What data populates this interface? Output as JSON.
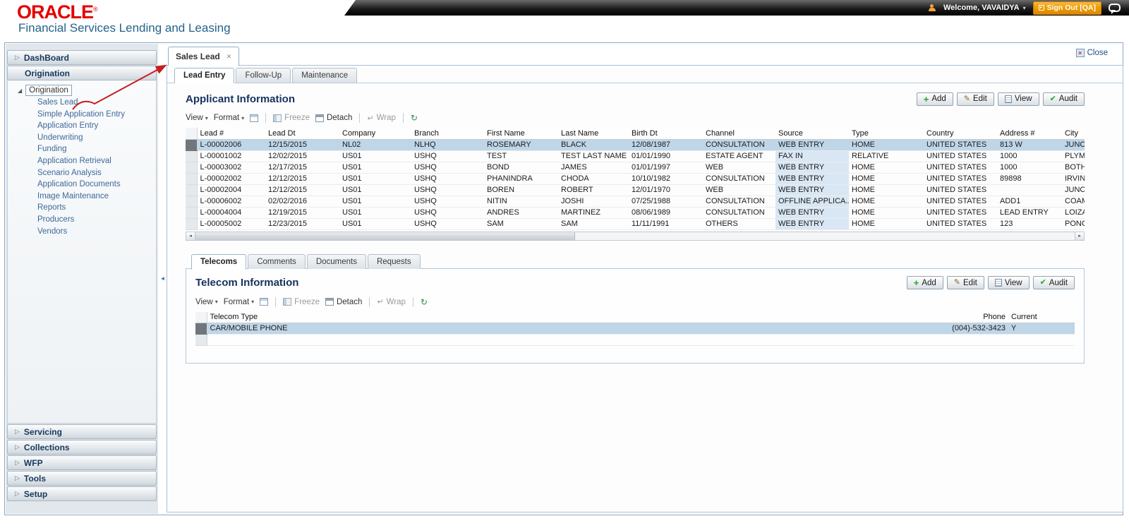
{
  "header": {
    "brand": "ORACLE",
    "brand_mark": "®",
    "subtitle": "Financial Services Lending and Leasing",
    "welcome": "Welcome, VAVAIDYA",
    "sign_out": "Sign Out [QA]"
  },
  "sidebar": {
    "dashboard_label": "DashBoard",
    "origination_label": "Origination",
    "tree_root": "Origination",
    "tree_items": [
      "Sales Lead",
      "Simple Application Entry",
      "Application Entry",
      "Underwriting",
      "Funding",
      "Application Retrieval",
      "Scenario Analysis",
      "Application Documents",
      "Image Maintenance",
      "Reports",
      "Producers",
      "Vendors"
    ],
    "sections_bottom": [
      "Servicing",
      "Collections",
      "WFP",
      "Tools",
      "Setup"
    ]
  },
  "window": {
    "tab_label": "Sales Lead",
    "close_label": "Close"
  },
  "tabs": [
    {
      "label": "Lead Entry",
      "active": true
    },
    {
      "label": "Follow-Up"
    },
    {
      "label": "Maintenance"
    }
  ],
  "toolbar_labels": {
    "view": "View",
    "format": "Format",
    "freeze": "Freeze",
    "detach": "Detach",
    "wrap": "Wrap"
  },
  "actions": [
    {
      "label": "Add"
    },
    {
      "label": "Edit"
    },
    {
      "label": "View"
    },
    {
      "label": "Audit"
    }
  ],
  "applicant": {
    "title": "Applicant Information",
    "columns": [
      "Lead #",
      "Lead Dt",
      "Company",
      "Branch",
      "First Name",
      "Last Name",
      "Birth Dt",
      "Channel",
      "Source",
      "Type",
      "Country",
      "Address #",
      "City"
    ],
    "rows": [
      {
        "selected": true,
        "cells": [
          "L-00002006",
          "12/15/2015",
          "NL02",
          "NLHQ",
          "ROSEMARY",
          "BLACK",
          "12/08/1987",
          "CONSULTATION",
          "WEB ENTRY",
          "HOME",
          "UNITED STATES",
          "813 W",
          "JUNCOS"
        ]
      },
      {
        "cells": [
          "L-00001002",
          "12/02/2015",
          "US01",
          "USHQ",
          "TEST",
          "TEST LAST NAME",
          "01/01/1990",
          "ESTATE AGENT",
          "FAX IN",
          "RELATIVE",
          "UNITED STATES",
          "1000",
          "PLYMOUTH"
        ]
      },
      {
        "cells": [
          "L-00003002",
          "12/17/2015",
          "US01",
          "USHQ",
          "BOND",
          "JAMES",
          "01/01/1997",
          "WEB",
          "WEB ENTRY",
          "HOME",
          "UNITED STATES",
          "1000",
          "BOTHELL"
        ]
      },
      {
        "cells": [
          "L-00002002",
          "12/12/2015",
          "US01",
          "USHQ",
          "PHANINDRA",
          "CHODA",
          "10/10/1982",
          "CONSULTATION",
          "WEB ENTRY",
          "HOME",
          "UNITED STATES",
          "89898",
          "IRVINE"
        ]
      },
      {
        "cells": [
          "L-00002004",
          "12/12/2015",
          "US01",
          "USHQ",
          "BOREN",
          "ROBERT",
          "12/01/1970",
          "WEB",
          "WEB ENTRY",
          "HOME",
          "UNITED STATES",
          "",
          "JUNCOS"
        ]
      },
      {
        "cells": [
          "L-00006002",
          "02/02/2016",
          "US01",
          "USHQ",
          "NITIN",
          "JOSHI",
          "07/25/1988",
          "CONSULTATION",
          "OFFLINE APPLICA...",
          "HOME",
          "UNITED STATES",
          "ADD1",
          "COAMO"
        ]
      },
      {
        "cells": [
          "L-00004004",
          "12/19/2015",
          "US01",
          "USHQ",
          "ANDRES",
          "MARTINEZ",
          "08/06/1989",
          "CONSULTATION",
          "WEB ENTRY",
          "HOME",
          "UNITED STATES",
          "LEAD ENTRY",
          "LOIZA"
        ]
      },
      {
        "cells": [
          "L-00005002",
          "12/23/2015",
          "US01",
          "USHQ",
          "SAM",
          "SAM",
          "11/11/1991",
          "OTHERS",
          "WEB ENTRY",
          "HOME",
          "UNITED STATES",
          "123",
          "PONCE"
        ]
      }
    ]
  },
  "detail_tabs": [
    {
      "label": "Telecoms",
      "active": true
    },
    {
      "label": "Comments"
    },
    {
      "label": "Documents"
    },
    {
      "label": "Requests"
    }
  ],
  "telecom": {
    "title": "Telecom Information",
    "columns": [
      "Telecom Type",
      "Phone",
      "Current"
    ],
    "rows": [
      {
        "selected": true,
        "cells": [
          "CAR/MOBILE PHONE",
          "(004)-532-3423",
          "Y"
        ]
      },
      {
        "cells": [
          "",
          "",
          ""
        ]
      }
    ]
  },
  "icons": {
    "caret": "▾",
    "chevron": "▷",
    "tree_expanded": "◢",
    "tab_close": "✕",
    "close_box": "✕",
    "add": "+",
    "edit": "✎",
    "audit": "✔",
    "wrap": "↵",
    "refresh": "↻",
    "scroll_left": "◂",
    "scroll_right": "▸",
    "splitter": "◄"
  },
  "colors": {
    "oracle_red": "#e40000",
    "subtitle_blue": "#24638c",
    "signout_orange": "#ef9c00",
    "annotation_red": "#c81e1e",
    "selected_row": "#bfd6e8",
    "source_column": "#d9e7f4",
    "link_blue": "#3f6899",
    "heading_navy": "#16325c"
  }
}
